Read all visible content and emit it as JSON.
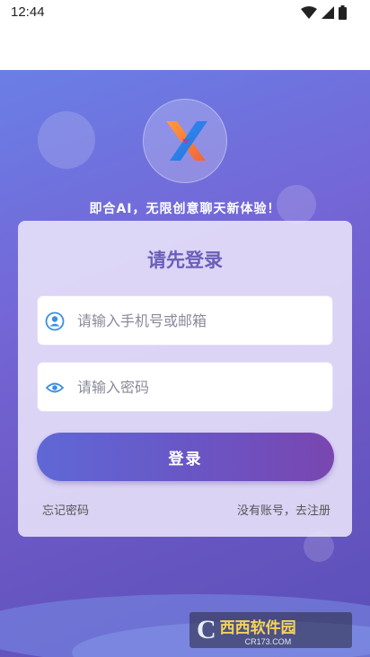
{
  "status_bar": {
    "time": "12:44"
  },
  "hero": {
    "slogan": "即合AI，无限创意聊天新体验！"
  },
  "login_card": {
    "title": "请先登录",
    "account_field": {
      "value": "",
      "placeholder": "请输入手机号或邮箱",
      "icon": "user-icon"
    },
    "password_field": {
      "value": "",
      "placeholder": "请输入密码",
      "icon": "eye-icon"
    },
    "login_button": "登录",
    "forgot_password": "忘记密码",
    "register_link": "没有账号，去注册"
  },
  "watermark": {
    "brand": "西西软件园",
    "url": "CR173.COM"
  },
  "colors": {
    "accent": "#6a5fb8",
    "button_start": "#5f68d6",
    "button_end": "#7a46b0",
    "icon_blue": "#3a8ee0"
  }
}
